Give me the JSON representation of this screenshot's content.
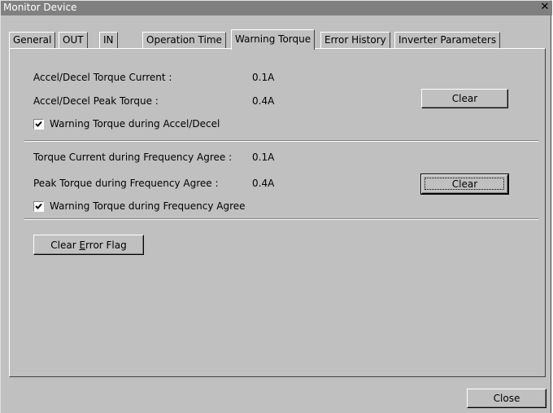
{
  "window": {
    "title": "Monitor Device",
    "close_glyph": "✕"
  },
  "tabs": [
    {
      "label": "General"
    },
    {
      "label": "OUT"
    },
    {
      "label": "IN"
    },
    {
      "label": "Operation Time"
    },
    {
      "label": "Warning Torque",
      "active": true
    },
    {
      "label": "Error History"
    },
    {
      "label": "Inverter Parameters"
    }
  ],
  "accel_section": {
    "torque_current_label": "Accel/Decel Torque Current :",
    "torque_current_value": "0.1A",
    "peak_torque_label": "Accel/Decel Peak Torque :",
    "peak_torque_value": "0.4A",
    "clear_label": "Clear",
    "warning_checkbox_label": "Warning Torque during Accel/Decel",
    "warning_checked": true
  },
  "freq_section": {
    "torque_current_label": "Torque Current during Frequency Agree :",
    "torque_current_value": "0.1A",
    "peak_torque_label": "Peak Torque during Frequency Agree :",
    "peak_torque_value": "0.4A",
    "clear_label": "Clear",
    "warning_checkbox_label": "Warning Torque during Frequency Agree",
    "warning_checked": true
  },
  "clear_error_flag": {
    "prefix": "Clear ",
    "accel": "E",
    "suffix": "rror Flag"
  },
  "footer": {
    "close_label": "Close"
  },
  "colors": {
    "face": "#c0c0c0",
    "titlebar": "#808080"
  }
}
